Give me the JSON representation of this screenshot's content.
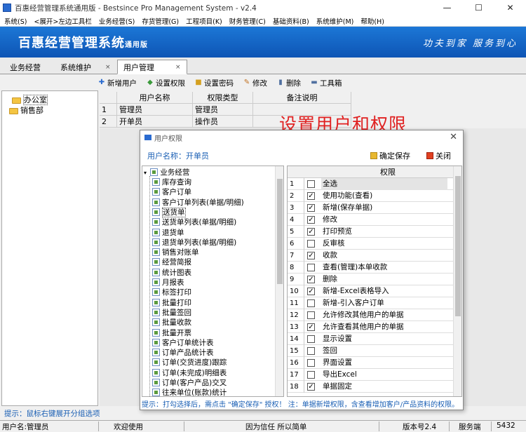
{
  "window": {
    "title": "百惠经营管理系统通用版 - Bestsince Pro Management System - v2.4",
    "min": "—",
    "max": "☐",
    "close": "✕"
  },
  "menu": [
    "系统(S)",
    "<展开>左边工具栏",
    "业务经营(S)",
    "存货管理(G)",
    "工程项目(K)",
    "财务管理(C)",
    "基础资料(B)",
    "系统维护(M)",
    "帮助(H)"
  ],
  "banner": {
    "logo": "百惠经营管理系统",
    "edition": "通用版",
    "slogan": "功夫到家 服务到心"
  },
  "tabs": [
    {
      "label": "业务经营",
      "close": ""
    },
    {
      "label": "系统维护",
      "close": "×"
    },
    {
      "label": "用户管理",
      "close": "×"
    }
  ],
  "toolbar": [
    {
      "label": "新增用户",
      "icon": "add-user-icon"
    },
    {
      "label": "设置权限",
      "icon": "permission-icon"
    },
    {
      "label": "设置密码",
      "icon": "lock-icon"
    },
    {
      "label": "修改",
      "icon": "edit-icon"
    },
    {
      "label": "删除",
      "icon": "trash-icon"
    },
    {
      "label": "工具箱",
      "icon": "toolbox-icon"
    }
  ],
  "departments": [
    "办公室",
    "销售部"
  ],
  "user_table": {
    "headers": [
      "用户名称",
      "权限类型",
      "备注说明"
    ],
    "rows": [
      {
        "n": "1",
        "name": "管理员",
        "type": "管理员",
        "note": ""
      },
      {
        "n": "2",
        "name": "开单员",
        "type": "操作员",
        "note": ""
      }
    ]
  },
  "annotation": "设置用户和权限",
  "dialog": {
    "title": "用户权限",
    "user_label": "用户名称：开单员",
    "save": "确定保存",
    "close": "关闭",
    "close_x": "✕",
    "tree_root": "业务经营",
    "tree_items": [
      "库存查询",
      "客户订单",
      "客户订单列表(单据/明细)",
      "送货单",
      "送货单列表(单据/明细)",
      "退货单",
      "退货单列表(单据/明细)",
      "销售对账单",
      "经营简报",
      "统计图表",
      "月报表",
      "标签打印",
      "批量打印",
      "批量签回",
      "批量收款",
      "批量开票",
      "客户订单统计表",
      "订单产品统计表",
      "订单(交货进度)跟踪",
      "订单(未完成)明细表",
      "订单(客户产品)交叉",
      "往来单位(账款)统计"
    ],
    "tree_selected": 3,
    "perm_header": "权限",
    "perms": [
      {
        "n": "1",
        "label": "全选",
        "checked": false
      },
      {
        "n": "2",
        "label": "使用功能(查看)",
        "checked": true
      },
      {
        "n": "3",
        "label": "新增(保存单据)",
        "checked": true
      },
      {
        "n": "4",
        "label": "修改",
        "checked": true
      },
      {
        "n": "5",
        "label": "打印预览",
        "checked": true
      },
      {
        "n": "6",
        "label": "反审核",
        "checked": false
      },
      {
        "n": "7",
        "label": "收款",
        "checked": true
      },
      {
        "n": "8",
        "label": "查看(管理)本单收款",
        "checked": false
      },
      {
        "n": "9",
        "label": "删除",
        "checked": true
      },
      {
        "n": "10",
        "label": "新增-Excel表格导入",
        "checked": true
      },
      {
        "n": "11",
        "label": "新增-引入客户订单",
        "checked": false
      },
      {
        "n": "12",
        "label": "允许修改其他用户的单据",
        "checked": false
      },
      {
        "n": "13",
        "label": "允许查看其他用户的单据",
        "checked": true
      },
      {
        "n": "14",
        "label": "显示设置",
        "checked": false
      },
      {
        "n": "15",
        "label": "签回",
        "checked": false
      },
      {
        "n": "16",
        "label": "界面设置",
        "checked": false
      },
      {
        "n": "17",
        "label": "导出Excel",
        "checked": false
      },
      {
        "n": "18",
        "label": "单据固定",
        "checked": true
      }
    ],
    "hint": "提示：打勾选择后，需点击 \"确定保存\" 授权！ 注：单据新增权限，含查看增加客户/产品资料的权限。"
  },
  "left_hint": "提示：鼠标右键展开分组选项",
  "status": {
    "user": "用户名:管理员",
    "welcome": "欢迎使用",
    "motto": "因为信任 所以简单",
    "version": "版本号2.4",
    "server": "服务端",
    "port": "5432"
  }
}
